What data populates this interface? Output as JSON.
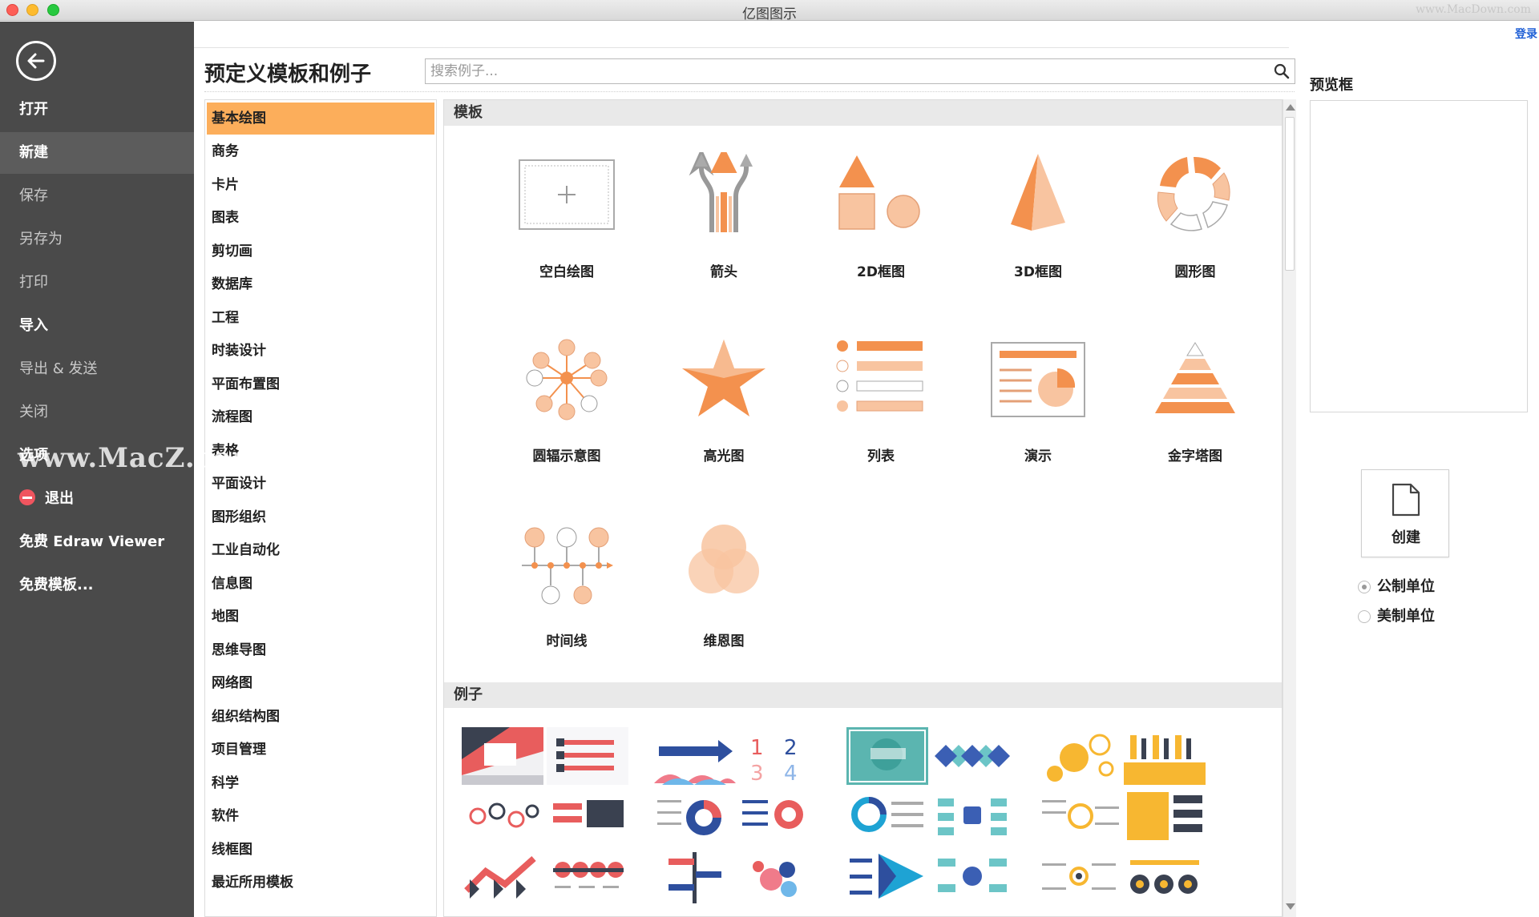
{
  "window": {
    "title": "亿图图示",
    "watermark_top": "www.MacDown.com"
  },
  "sidebar": {
    "items": [
      {
        "label": "打开",
        "state": "normal"
      },
      {
        "label": "新建",
        "state": "active"
      },
      {
        "label": "保存",
        "state": "dim"
      },
      {
        "label": "另存为",
        "state": "dim"
      },
      {
        "label": "打印",
        "state": "dim"
      },
      {
        "label": "导入",
        "state": "normal"
      },
      {
        "label": "导出 & 发送",
        "state": "dim"
      },
      {
        "label": "关闭",
        "state": "dim"
      },
      {
        "label": "选项",
        "state": "normal"
      },
      {
        "label": "退出",
        "state": "normal"
      },
      {
        "label": "免费 Edraw Viewer",
        "state": "normal"
      },
      {
        "label": "免费模板...",
        "state": "normal"
      }
    ],
    "watermark": "www.MacZ.com"
  },
  "header": {
    "login": "登录",
    "title": "预定义模板和例子",
    "search_placeholder": "搜索例子..."
  },
  "categories": [
    "基本绘图",
    "商务",
    "卡片",
    "图表",
    "剪切画",
    "数据库",
    "工程",
    "时装设计",
    "平面布置图",
    "流程图",
    "表格",
    "平面设计",
    "图形组织",
    "工业自动化",
    "信息图",
    "地图",
    "思维导图",
    "网络图",
    "组织结构图",
    "项目管理",
    "科学",
    "软件",
    "线框图",
    "最近所用模板"
  ],
  "selected_category": "基本绘图",
  "main": {
    "templates_header": "模板",
    "examples_header": "例子",
    "templates": [
      {
        "label": "空白绘图",
        "icon": "blank-drawing-icon"
      },
      {
        "label": "箭头",
        "icon": "arrows-icon"
      },
      {
        "label": "2D框图",
        "icon": "2d-shapes-icon"
      },
      {
        "label": "3D框图",
        "icon": "3d-pyramid-icon"
      },
      {
        "label": "圆形图",
        "icon": "circular-diagram-icon"
      },
      {
        "label": "圆辐示意图",
        "icon": "radial-diagram-icon"
      },
      {
        "label": "高光图",
        "icon": "highlight-star-icon"
      },
      {
        "label": "列表",
        "icon": "list-icon"
      },
      {
        "label": "演示",
        "icon": "presentation-icon"
      },
      {
        "label": "金字塔图",
        "icon": "pyramid-icon"
      },
      {
        "label": "时间线",
        "icon": "timeline-icon"
      },
      {
        "label": "维恩图",
        "icon": "venn-icon"
      }
    ]
  },
  "preview": {
    "title": "预览框",
    "create_label": "创建",
    "units": [
      {
        "label": "公制单位",
        "checked": true
      },
      {
        "label": "美制单位",
        "checked": false
      }
    ]
  },
  "colors": {
    "accent_orange": "#f3914e",
    "light_orange": "#f8c4a0",
    "selected_category_bg": "#fcae5b",
    "sidebar_bg": "#4a4a4a"
  }
}
